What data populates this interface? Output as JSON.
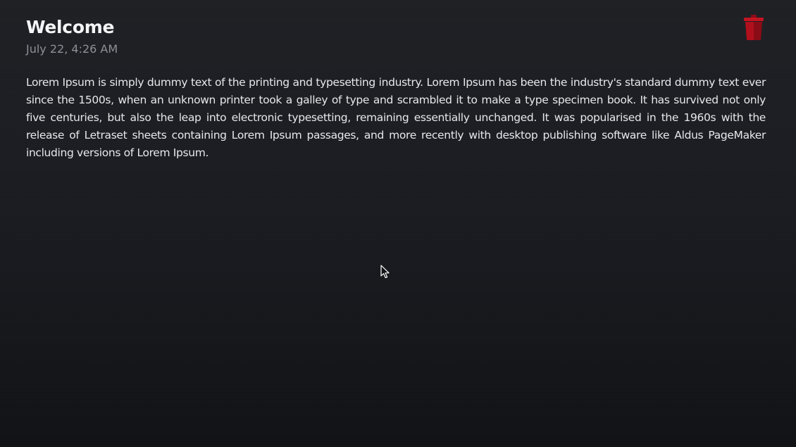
{
  "note": {
    "title": "Welcome",
    "date": "July 22, 4:26 AM",
    "body": "Lorem Ipsum is simply dummy text of the printing and typesetting industry. Lorem Ipsum has been the industry's standard dummy text ever since the 1500s, when an unknown printer took a galley of type and scrambled it to make a type specimen book. It has survived not only five centuries, but also the leap into electronic typesetting, remaining essentially unchanged. It was popularised in the 1960s with the release of Letraset sheets containing Lorem Ipsum passages, and more recently with desktop publishing software like Aldus PageMaker including versions of Lorem Ipsum."
  },
  "actions": {
    "delete_icon": "trash-icon",
    "delete_color": "#b0101c"
  },
  "colors": {
    "background": "#1a1c21",
    "text": "#e6e8ea",
    "muted": "#8c9096"
  }
}
